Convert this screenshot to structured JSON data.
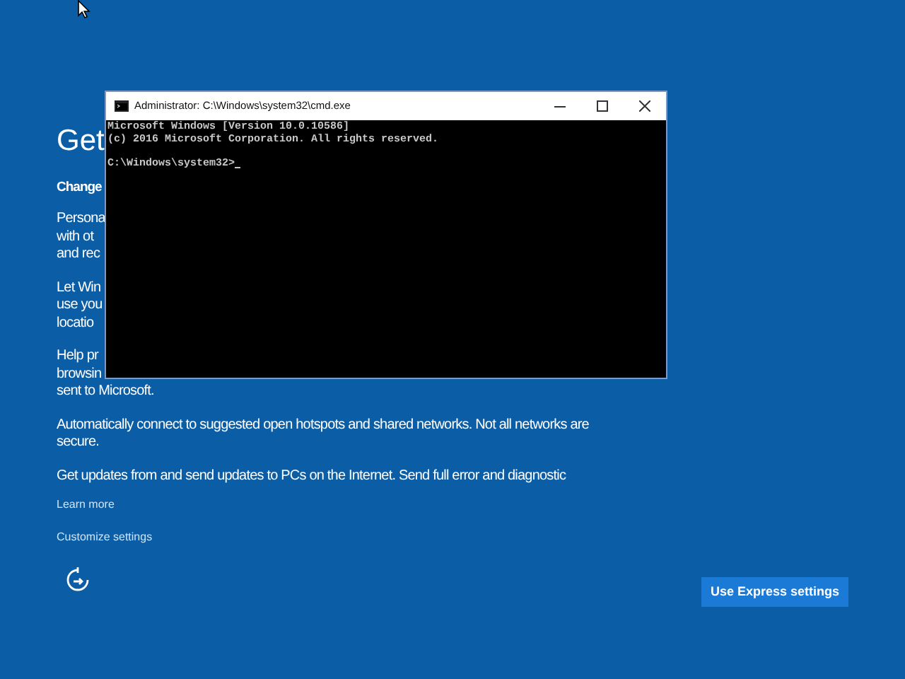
{
  "page": {
    "heading": "Get",
    "subheading": "Change",
    "paragraphs": [
      {
        "lines": [
          "Persona",
          "with ot",
          "and rec"
        ]
      },
      {
        "lines": [
          "Let Win",
          "use you",
          "locatio"
        ]
      },
      {
        "lines": [
          "Help pr",
          "browsin",
          "sent to Microsoft."
        ]
      },
      {
        "lines": [
          "Automatically connect to suggested open hotspots and shared networks. Not all networks are",
          "secure."
        ]
      },
      {
        "lines": [
          "Get updates from and send updates to PCs on the Internet. Send full error and diagnostic"
        ]
      }
    ],
    "links": [
      "Learn more",
      "Customize settings"
    ],
    "primary_button": "Use Express settings"
  },
  "console_window": {
    "title": "Administrator: C:\\Windows\\system32\\cmd.exe",
    "lines": [
      "Microsoft Windows [Version 10.0.10586]",
      "(c) 2016 Microsoft Corporation. All rights reserved."
    ],
    "prompt": "C:\\Windows\\system32>",
    "cursor": true
  }
}
